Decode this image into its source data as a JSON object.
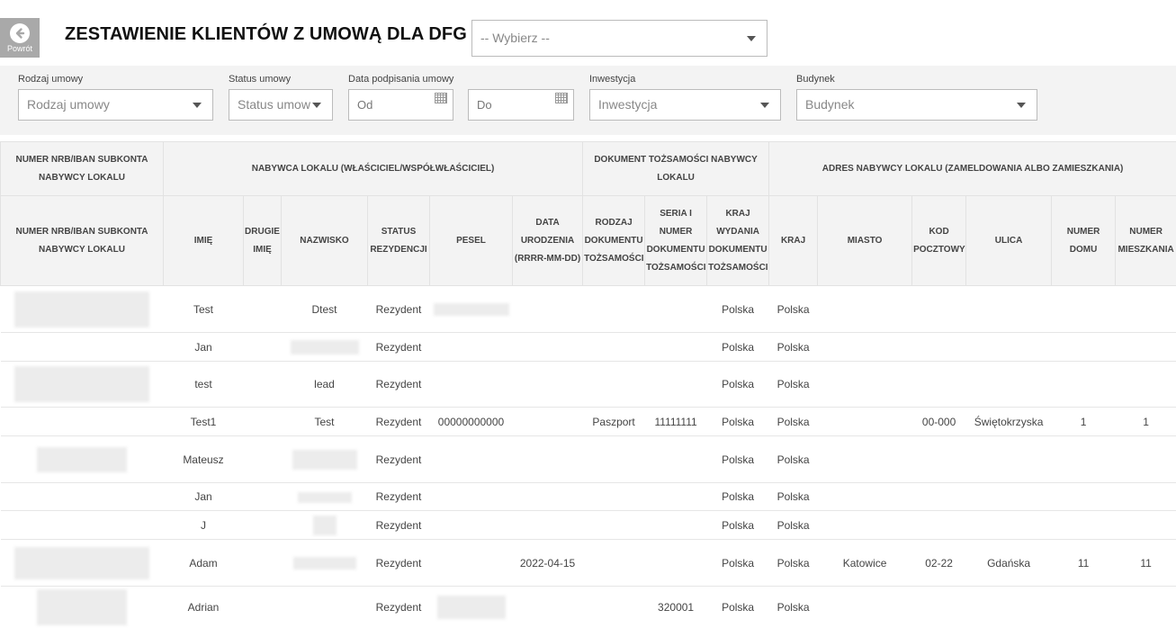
{
  "header": {
    "back_label": "Powrót",
    "title": "ZESTAWIENIE KLIENTÓW Z UMOWĄ DLA DFG",
    "select_placeholder": "-- Wybierz --"
  },
  "filters": {
    "contract_type": {
      "label": "Rodzaj umowy",
      "placeholder": "Rodzaj umowy"
    },
    "contract_status": {
      "label": "Status umowy",
      "placeholder": "Status umow"
    },
    "sign_date": {
      "label": "Data podpisania umowy",
      "from": "Od",
      "to": "Do"
    },
    "investment": {
      "label": "Inwestycja",
      "placeholder": "Inwestycja"
    },
    "building": {
      "label": "Budynek",
      "placeholder": "Budynek"
    }
  },
  "table": {
    "group_headers": [
      "NUMER NRB/IBAN SUBKONTA NABYWCY LOKALU",
      "NABYWCA LOKALU (WŁAŚCICIEL/WSPÓŁWŁAŚCICIEL)",
      "DOKUMENT TOŻSAMOŚCI NABYWCY LOKALU",
      "ADRES NABYWCY LOKALU (ZAMELDOWANIA ALBO ZAMIESZKANIA)"
    ],
    "columns": [
      "NUMER NRB/IBAN SUBKONTA NABYWCY LOKALU",
      "IMIĘ",
      "DRUGIE IMIĘ",
      "NAZWISKO",
      "STATUS REZYDENCJI",
      "PESEL",
      "DATA URODZENIA (RRRR-MM-DD)",
      "RODZAJ DOKUMENTU TOŻSAMOŚCI",
      "SERIA I NUMER DOKUMENTU TOŻSAMOŚCI",
      "KRAJ WYDANIA DOKUMENTU TOŻSAMOŚCI",
      "KRAJ",
      "MIASTO",
      "KOD POCZTOWY",
      "ULICA",
      "NUMER DOMU",
      "NUMER MIESZKANIA"
    ],
    "rows": [
      {
        "first_name": "Test",
        "second_name": "",
        "last_name": "Dtest",
        "residency": "Rezydent",
        "pesel": "",
        "birth_date": "",
        "doc_type": "",
        "doc_number": "",
        "doc_country": "Polska",
        "country": "Polska",
        "city": "",
        "postal_code": "",
        "street": "",
        "house_no": "",
        "flat_no": ""
      },
      {
        "first_name": "Jan",
        "second_name": "",
        "last_name": "",
        "residency": "Rezydent",
        "pesel": "",
        "birth_date": "",
        "doc_type": "",
        "doc_number": "",
        "doc_country": "Polska",
        "country": "Polska",
        "city": "",
        "postal_code": "",
        "street": "",
        "house_no": "",
        "flat_no": ""
      },
      {
        "first_name": "test",
        "second_name": "",
        "last_name": "lead",
        "residency": "Rezydent",
        "pesel": "",
        "birth_date": "",
        "doc_type": "",
        "doc_number": "",
        "doc_country": "Polska",
        "country": "Polska",
        "city": "",
        "postal_code": "",
        "street": "",
        "house_no": "",
        "flat_no": ""
      },
      {
        "first_name": "Test1",
        "second_name": "",
        "last_name": "Test",
        "residency": "Rezydent",
        "pesel": "00000000000",
        "birth_date": "",
        "doc_type": "Paszport",
        "doc_number": "11111111",
        "doc_country": "Polska",
        "country": "Polska",
        "city": "",
        "postal_code": "00-000",
        "street": "Świętokrzyska",
        "house_no": "1",
        "flat_no": "1"
      },
      {
        "first_name": "Mateusz",
        "second_name": "",
        "last_name": "",
        "residency": "Rezydent",
        "pesel": "",
        "birth_date": "",
        "doc_type": "",
        "doc_number": "",
        "doc_country": "Polska",
        "country": "Polska",
        "city": "",
        "postal_code": "",
        "street": "",
        "house_no": "",
        "flat_no": ""
      },
      {
        "first_name": "Jan",
        "second_name": "",
        "last_name": "",
        "residency": "Rezydent",
        "pesel": "",
        "birth_date": "",
        "doc_type": "",
        "doc_number": "",
        "doc_country": "Polska",
        "country": "Polska",
        "city": "",
        "postal_code": "",
        "street": "",
        "house_no": "",
        "flat_no": ""
      },
      {
        "first_name": "J",
        "second_name": "",
        "last_name": "",
        "residency": "Rezydent",
        "pesel": "",
        "birth_date": "",
        "doc_type": "",
        "doc_number": "",
        "doc_country": "Polska",
        "country": "Polska",
        "city": "",
        "postal_code": "",
        "street": "",
        "house_no": "",
        "flat_no": ""
      },
      {
        "first_name": "Adam",
        "second_name": "",
        "last_name": "",
        "residency": "Rezydent",
        "pesel": "",
        "birth_date": "2022-04-15",
        "doc_type": "",
        "doc_number": "",
        "doc_country": "Polska",
        "country": "Polska",
        "city": "Katowice",
        "postal_code": "02-22",
        "street": "Gdańska",
        "house_no": "11",
        "flat_no": "11"
      },
      {
        "first_name": "Adrian",
        "second_name": "",
        "last_name": "",
        "residency": "Rezydent",
        "pesel": "",
        "birth_date": "",
        "doc_type": "",
        "doc_number": "320001",
        "doc_country": "Polska",
        "country": "Polska",
        "city": "",
        "postal_code": "",
        "street": "",
        "house_no": "",
        "flat_no": ""
      }
    ]
  }
}
